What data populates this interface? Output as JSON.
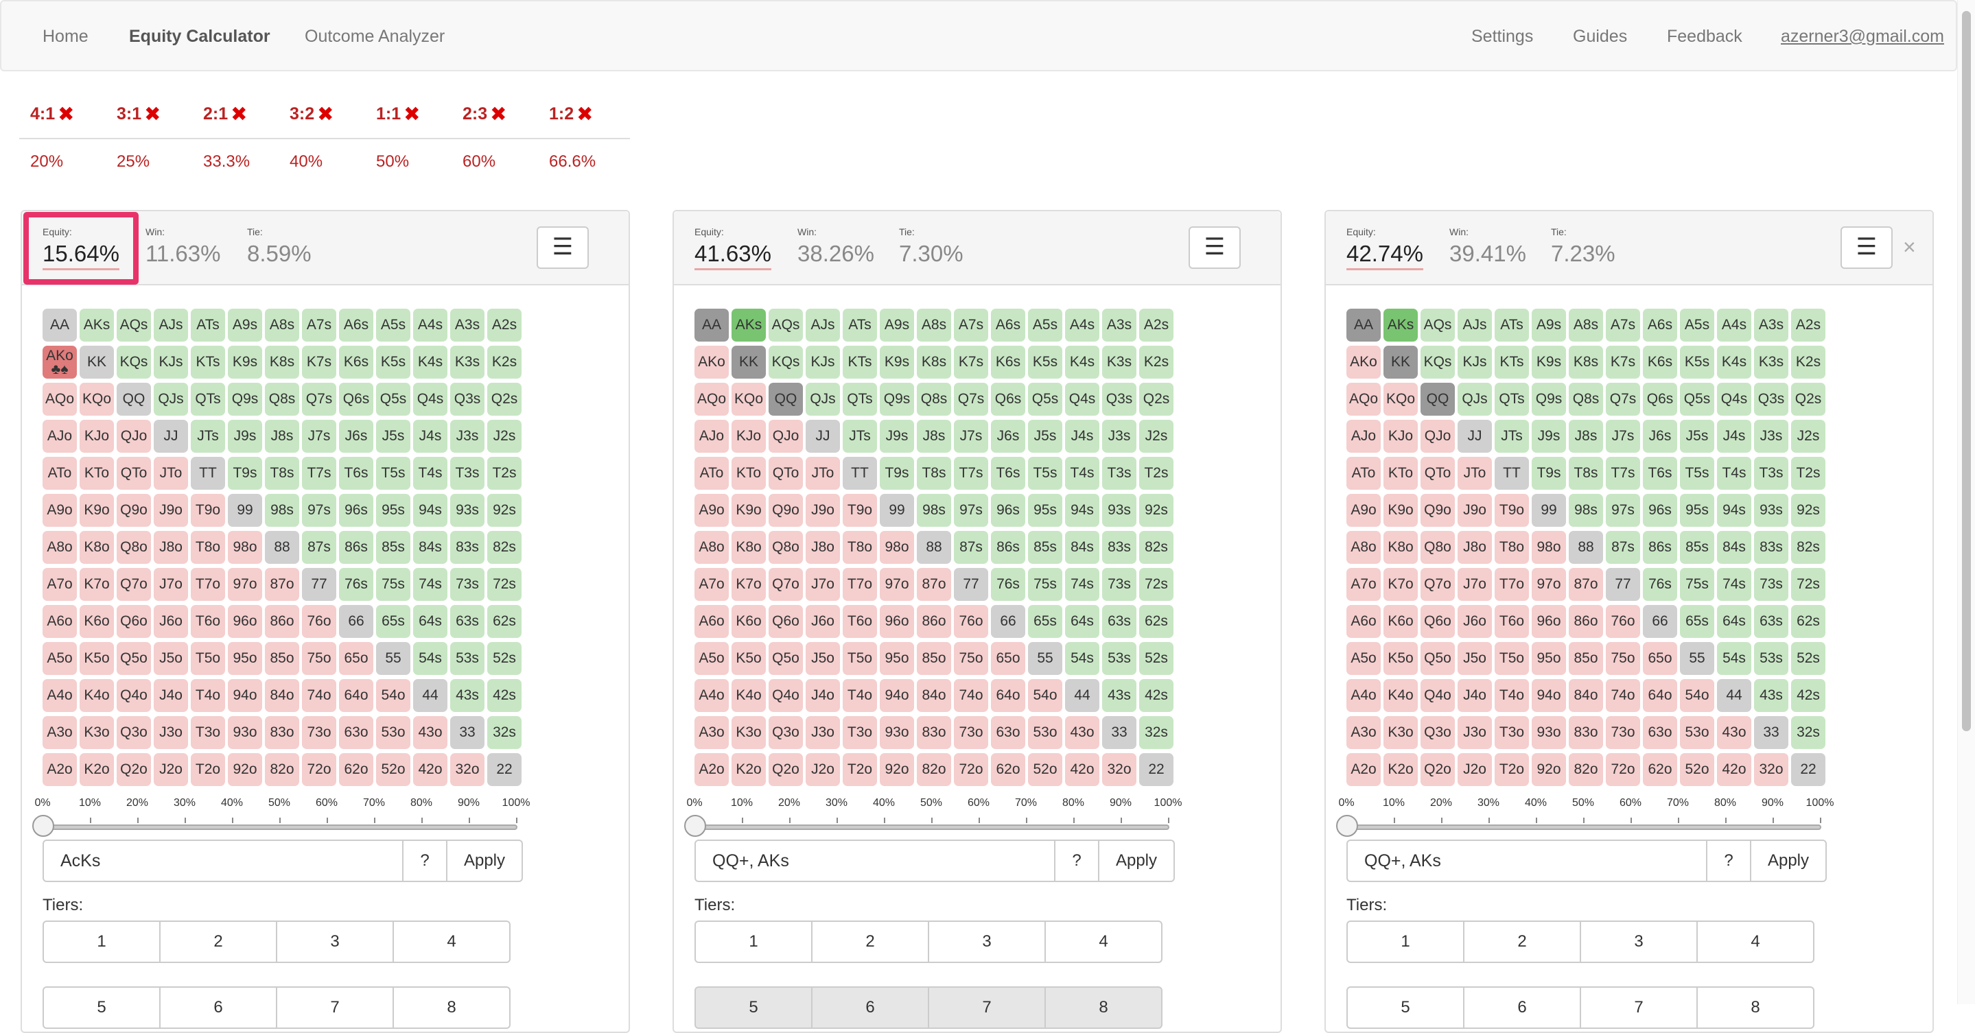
{
  "nav": {
    "left": [
      "Home",
      "Equity Calculator",
      "Outcome Analyzer"
    ],
    "active": "Equity Calculator",
    "right": [
      "Settings",
      "Guides",
      "Feedback",
      "azerner3@gmail.com"
    ]
  },
  "odds": [
    {
      "ratio": "4:1",
      "pct": "20%"
    },
    {
      "ratio": "3:1",
      "pct": "25%"
    },
    {
      "ratio": "2:1",
      "pct": "33.3%"
    },
    {
      "ratio": "3:2",
      "pct": "40%"
    },
    {
      "ratio": "1:1",
      "pct": "50%"
    },
    {
      "ratio": "2:3",
      "pct": "60%"
    },
    {
      "ratio": "1:2",
      "pct": "66.6%"
    }
  ],
  "labels": {
    "equity": "Equity:",
    "win": "Win:",
    "tie": "Tie:",
    "tiers": "Tiers:",
    "apply": "Apply",
    "help": "?"
  },
  "icons": {
    "menu": "hamburger-icon",
    "close": "close-icon",
    "odds_mark": "x-mark-icon"
  },
  "scale": [
    "0%",
    "10%",
    "20%",
    "30%",
    "40%",
    "50%",
    "60%",
    "70%",
    "80%",
    "90%",
    "100%"
  ],
  "tiers": [
    "1",
    "2",
    "3",
    "4",
    "5",
    "6",
    "7",
    "8"
  ],
  "panels": [
    {
      "equity": "15.64%",
      "win": "11.63%",
      "tie": "8.59%",
      "range": "AcKs",
      "slider_pct": 0,
      "selected": {
        "AKo": "suits"
      },
      "closable": false,
      "highlight": true
    },
    {
      "equity": "41.63%",
      "win": "38.26%",
      "tie": "7.30%",
      "range": "QQ+, AKs",
      "slider_pct": 0,
      "selected": {
        "AA": "grey",
        "KK": "grey",
        "QQ": "grey",
        "AKs": "green"
      },
      "closable": false,
      "highlight": false
    },
    {
      "equity": "42.74%",
      "win": "39.41%",
      "tie": "7.23%",
      "range": "QQ+, AKs",
      "slider_pct": 0,
      "selected": {
        "AA": "grey",
        "KK": "grey",
        "QQ": "grey",
        "AKs": "green"
      },
      "closable": true,
      "highlight": false
    }
  ],
  "suit_glyphs": "♣♠",
  "colors": {
    "suited": "#c8e6c4",
    "offsuit": "#f5cece",
    "pair": "#d0d0d0",
    "selected_pair": "#999999",
    "selected_suited": "#79c471",
    "selected_offsuit": "#e07b7b",
    "highlight": "#e8336a",
    "odds_red": "#bb2222"
  }
}
